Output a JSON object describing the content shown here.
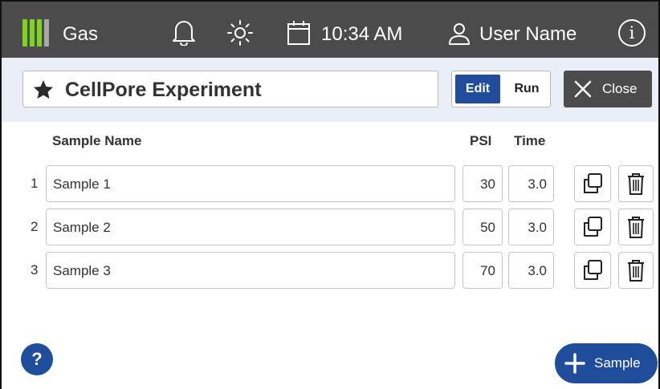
{
  "statusbar": {
    "gas_label": "Gas",
    "time": "10:34 AM",
    "user_name": "User Name",
    "info_glyph": "i"
  },
  "header": {
    "experiment_title": "CellPore Experiment",
    "mode_options": [
      "Edit",
      "Run"
    ],
    "selected_mode": "Edit",
    "close_label": "Close"
  },
  "table": {
    "columns": {
      "sample_name": "Sample Name",
      "psi": "PSI",
      "time": "Time"
    },
    "rows": [
      {
        "index": "1",
        "name": "Sample 1",
        "psi": "30",
        "time": "3.0"
      },
      {
        "index": "2",
        "name": "Sample 2",
        "psi": "50",
        "time": "3.0"
      },
      {
        "index": "3",
        "name": "Sample 3",
        "psi": "70",
        "time": "3.0"
      }
    ]
  },
  "footer": {
    "help_label": "?",
    "add_sample_label": "Sample"
  },
  "colors": {
    "accent": "#1f4d9c",
    "statusbar_bg": "#4b4b4b",
    "header_bg": "#e9eef7",
    "gas_level": "#7ed321"
  },
  "icons": {
    "gas": "gas-level-icon",
    "notifications": "bell-icon",
    "brightness": "sun-icon",
    "date": "calendar-icon",
    "user": "user-icon",
    "info": "info-icon",
    "favorite": "star-icon",
    "close": "close-icon",
    "duplicate": "copy-icon",
    "delete": "trash-icon",
    "add": "plus-icon"
  }
}
